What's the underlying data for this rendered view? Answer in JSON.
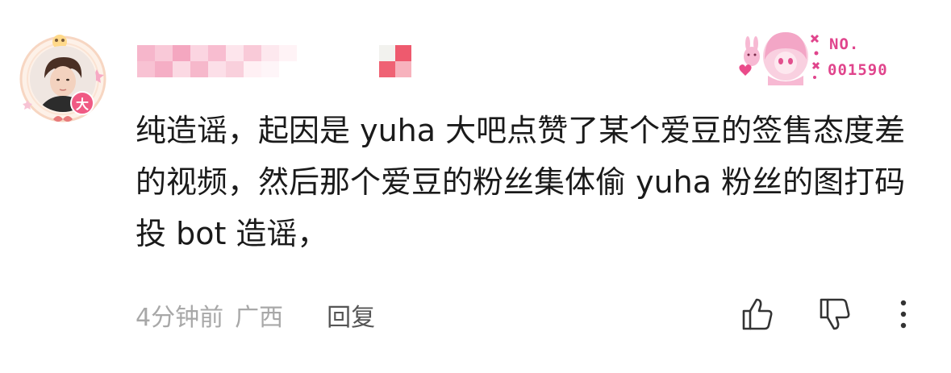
{
  "comment": {
    "level_badge": "大",
    "fan_badge": {
      "label": "NO.",
      "number": "001590"
    },
    "text": "纯造谣，起因是 yuha 大吧点赞了某个爱豆的签售态度差的视频，然后那个爱豆的粉丝集体偷 yuha 粉丝的图打码投 bot 造谣，",
    "time": "4分钟前",
    "location": "广西",
    "reply_label": "回复"
  },
  "icons": {
    "like": "thumbs-up-icon",
    "dislike": "thumbs-down-icon",
    "more": "more-vertical-icon"
  },
  "colors": {
    "badge_pink": "#f05a84",
    "fan_badge_pink": "#e0448c",
    "meta_gray": "#a8a8a8",
    "text_dark": "#1a1a1a"
  }
}
